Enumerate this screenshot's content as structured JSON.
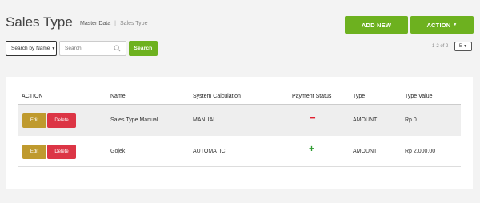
{
  "header": {
    "title": "Sales Type",
    "breadcrumb": [
      "Master Data",
      "Sales Type"
    ],
    "add_new_label": "ADD NEW",
    "action_label": "ACTION"
  },
  "filter": {
    "select_label": "Search by Name",
    "search_placeholder": "Search",
    "search_button_label": "Search"
  },
  "pagination": {
    "range_text": "1-2 of 2",
    "page_size": "5"
  },
  "colors": {
    "primary_green": "#6db11f",
    "edit_gold": "#bf9a2e",
    "delete_red": "#dc3545",
    "status_minus": "#e02030",
    "status_plus": "#2e9b30"
  },
  "table": {
    "columns": [
      "ACTION",
      "Name",
      "System Calculation",
      "Payment Status",
      "Type",
      "Type Value"
    ],
    "edit_label": "Edit",
    "delete_label": "Delete",
    "rows": [
      {
        "name": "Sales Type Manual",
        "system_calculation": "MANUAL",
        "payment_status": "−",
        "type": "AMOUNT",
        "type_value": "Rp 0"
      },
      {
        "name": "Gojek",
        "system_calculation": "AUTOMATIC",
        "payment_status": "+",
        "type": "AMOUNT",
        "type_value": "Rp 2.000,00"
      }
    ]
  }
}
